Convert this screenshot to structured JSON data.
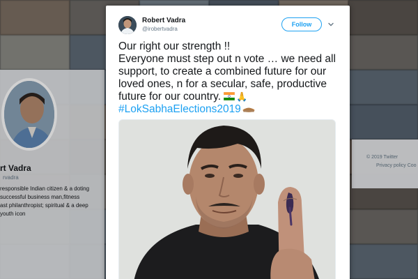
{
  "background": {
    "profile_name": "rt Vadra",
    "profile_handle": "rvadra",
    "bio_lines": [
      "responsible Indian citizen & a doting",
      "successful business man,fitness",
      "ast philanthropist; spiritual & a deep",
      "youth icon"
    ],
    "footer_copyright": "© 2019 Twitter",
    "footer_links": "Privacy policy  Coo"
  },
  "tweet": {
    "author_name": "Robert Vadra",
    "author_handle": "@irobertvadra",
    "follow_label": "Follow",
    "lines": [
      "Our right our strength !!",
      "Everyone must step out n vote … we need all",
      "support, to create a combined future for our",
      "loved ones, n for a secular, safe, productive",
      "future for our country."
    ],
    "hashtag": "#LokSabhaElections2019"
  },
  "icons": {
    "flag": "india-flag-icon",
    "pray": "folded-hands-icon",
    "building": "parliament-building-icon",
    "caret": "chevron-down-icon"
  },
  "colors": {
    "accent": "#1da1f2",
    "text": "#14171a",
    "muted": "#657786"
  }
}
